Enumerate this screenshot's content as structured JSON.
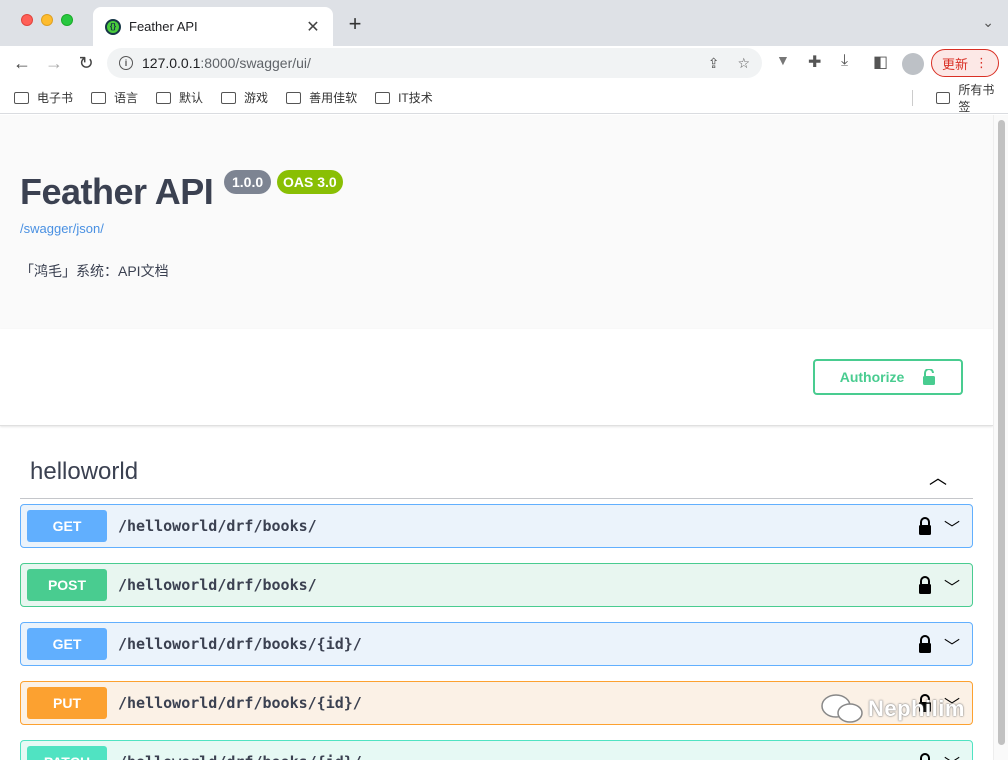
{
  "browser": {
    "tab_title": "Feather API",
    "url_host": "127.0.0.1",
    "url_rest": ":8000/swagger/ui/",
    "update_label": "更新",
    "bookmarks": [
      "电子书",
      "语言",
      "默认",
      "游戏",
      "善用佳软",
      "IT技术"
    ],
    "all_bookmarks": "所有书签"
  },
  "info": {
    "title": "Feather API",
    "version": "1.0.0",
    "oas": "OAS 3.0",
    "spec_link": "/swagger/json/",
    "description": "「鸿毛」系统：API文档"
  },
  "auth": {
    "label": "Authorize"
  },
  "tag": {
    "name": "helloworld"
  },
  "operations": [
    {
      "method": "GET",
      "path": "/helloworld/drf/books/"
    },
    {
      "method": "POST",
      "path": "/helloworld/drf/books/"
    },
    {
      "method": "GET",
      "path": "/helloworld/drf/books/{id}/"
    },
    {
      "method": "PUT",
      "path": "/helloworld/drf/books/{id}/"
    },
    {
      "method": "PATCH",
      "path": "/helloworld/drf/books/{id}/"
    }
  ],
  "watermark": "Nephilim",
  "colors": {
    "get": "#61affe",
    "post": "#49cc90",
    "put": "#fca130",
    "patch": "#50e3c2",
    "authorize": "#49cc90",
    "oas_badge": "#89bf04"
  }
}
